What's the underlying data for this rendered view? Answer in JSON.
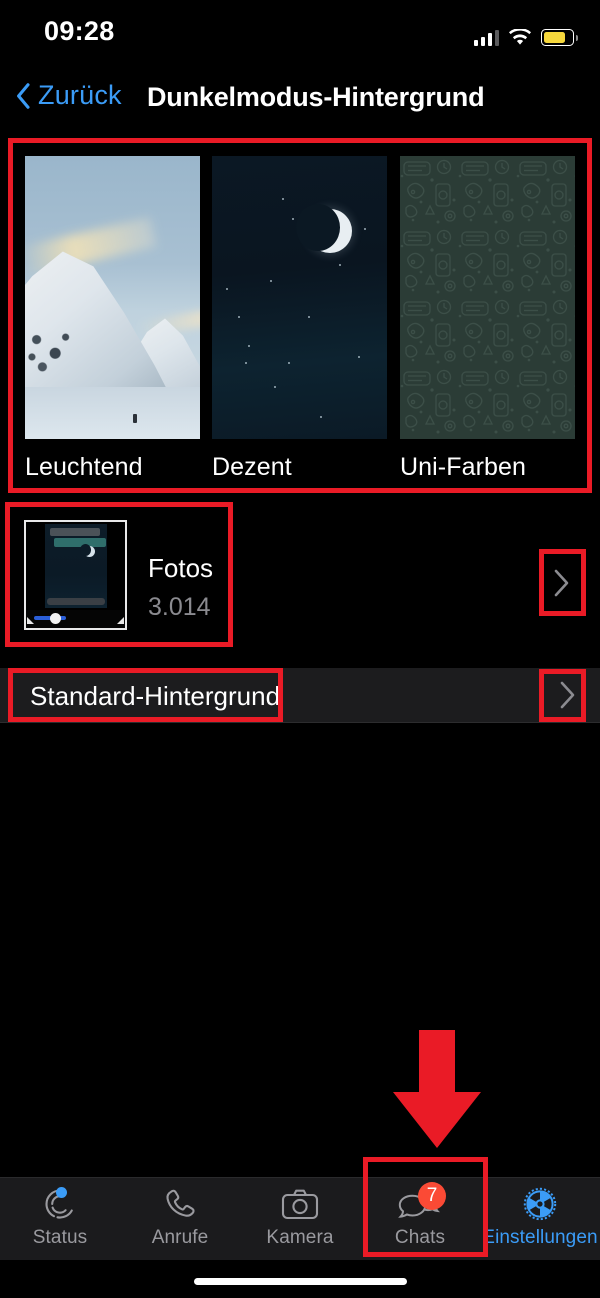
{
  "status_bar": {
    "time": "09:28",
    "signal_icon": "cellular-signal-icon",
    "wifi_icon": "wifi-icon",
    "battery_icon": "battery-low-power-icon",
    "battery_color": "#f5d73c"
  },
  "nav_bar": {
    "back_label": "Zurück",
    "back_icon": "chevron-left-icon",
    "title": "Dunkelmodus-Hintergrund",
    "accent_color": "#3b9cf7"
  },
  "wallpaper_options": [
    {
      "label": "Leuchtend",
      "kind": "photo-mountain"
    },
    {
      "label": "Dezent",
      "kind": "photo-night-moon"
    },
    {
      "label": "Uni-Farben",
      "kind": "doodle-pattern"
    }
  ],
  "rows": [
    {
      "title": "Fotos",
      "subtitle": "3.014",
      "thumbnail": "photo-library-thumbnail",
      "chevron_icon": "chevron-right-icon"
    },
    {
      "title": "Standard-Hintergrund",
      "chevron_icon": "chevron-right-icon"
    }
  ],
  "tab_bar": {
    "items": [
      {
        "label": "Status",
        "icon": "status-ring-icon",
        "active": false,
        "dot": true
      },
      {
        "label": "Anrufe",
        "icon": "phone-icon",
        "active": false
      },
      {
        "label": "Kamera",
        "icon": "camera-icon",
        "active": false
      },
      {
        "label": "Chats",
        "icon": "chats-bubbles-icon",
        "active": false,
        "badge": "7"
      },
      {
        "label": "Einstellungen",
        "icon": "gear-icon",
        "active": true
      }
    ],
    "badge_color": "#fb4a35",
    "active_color": "#3b9cf7",
    "inactive_color": "#9a9a9f"
  },
  "annotations": {
    "color": "#ea1b26",
    "arrow_icon": "down-arrow-annotation",
    "boxes": [
      "wallpaper-options-highlight",
      "fotos-row-highlight",
      "fotos-chevron-highlight",
      "standard-hintergrund-highlight",
      "standard-chevron-highlight",
      "chats-tab-highlight"
    ]
  }
}
